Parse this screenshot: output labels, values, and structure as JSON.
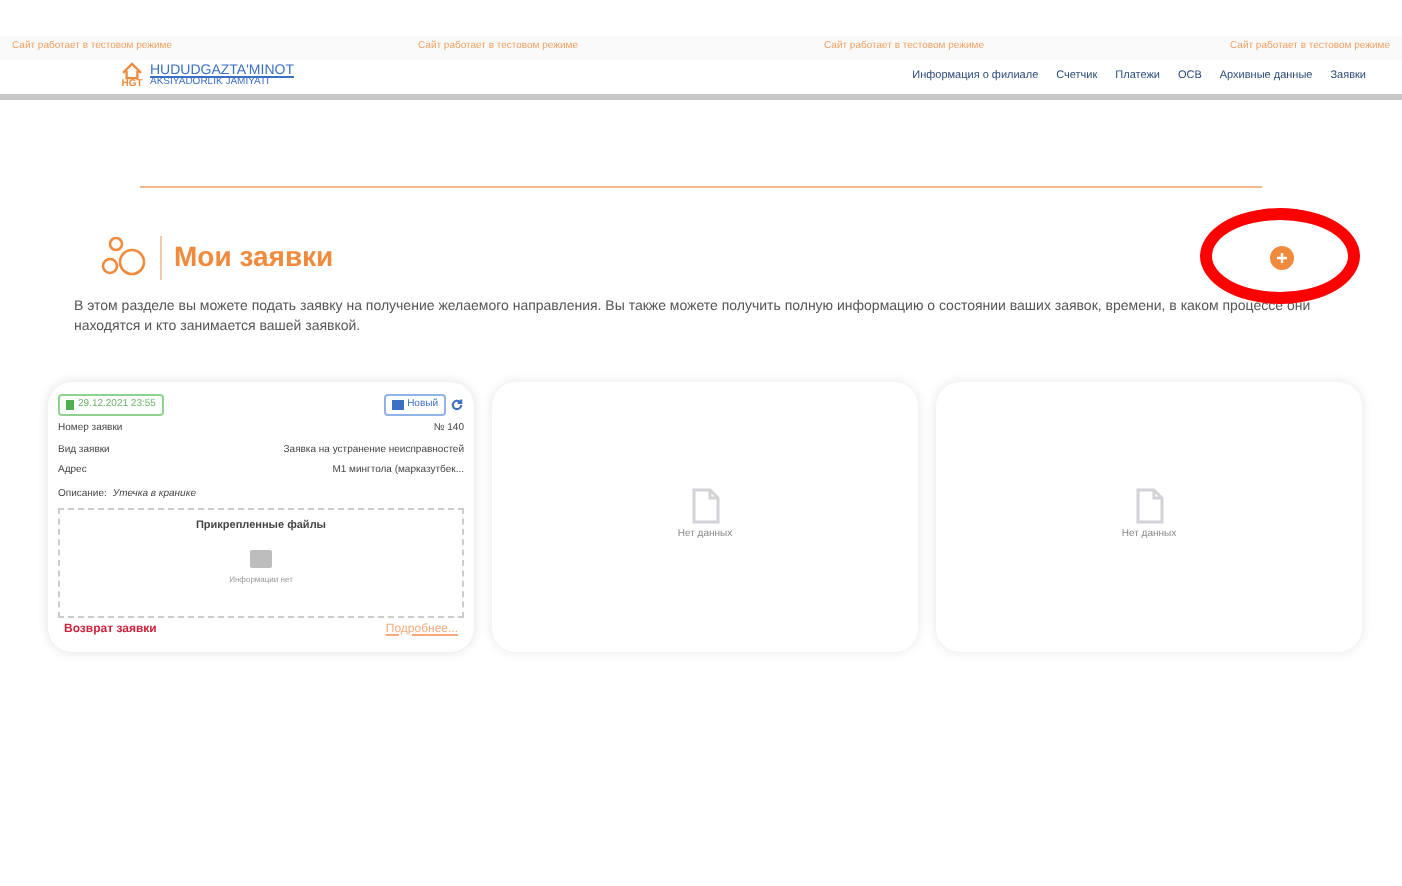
{
  "test_banner": [
    "Сайт работает в тестовом режиме",
    "Сайт работает в тестовом режиме",
    "Сайт работает в тестовом режиме",
    "Сайт работает в тестовом режиме"
  ],
  "logo": {
    "name": "HUDUDGAZTA'MINOT",
    "tagline": "AKSIYADORLIK JAMIYATI",
    "mark": "HGT"
  },
  "nav": [
    "Информация о филиале",
    "Счетчик",
    "Платежи",
    "ОСВ",
    "Архивные данные",
    "Заявки"
  ],
  "page": {
    "title": "Мои заявки",
    "description": "В этом разделе вы можете подать заявку на получение желаемого направления. Вы также можете получить полную информацию о состоянии ваших заявок, времени, в каком процессе они находятся и кто занимается вашей заявкой."
  },
  "cards": [
    {
      "kind": "request",
      "date": "29.12.2021 23:55",
      "status": "Новый",
      "fields": [
        {
          "label": "Номер заявки",
          "value": "№ 140"
        },
        {
          "label": "Вид заявки",
          "value": "Заявка на устранение неисправностей"
        },
        {
          "label": "Адрес",
          "value": "М1 мингтола (марказутбек..."
        }
      ],
      "description_label": "Описание:",
      "description": "Утечка в кранике",
      "attachments_title": "Прикрепленные файлы",
      "attachments_empty": "Информации нет",
      "return_link": "Возврат заявки",
      "more_link": "Подробнее..."
    },
    {
      "kind": "empty",
      "empty_text": "Нет данных"
    },
    {
      "kind": "empty",
      "empty_text": "Нет данных"
    }
  ]
}
